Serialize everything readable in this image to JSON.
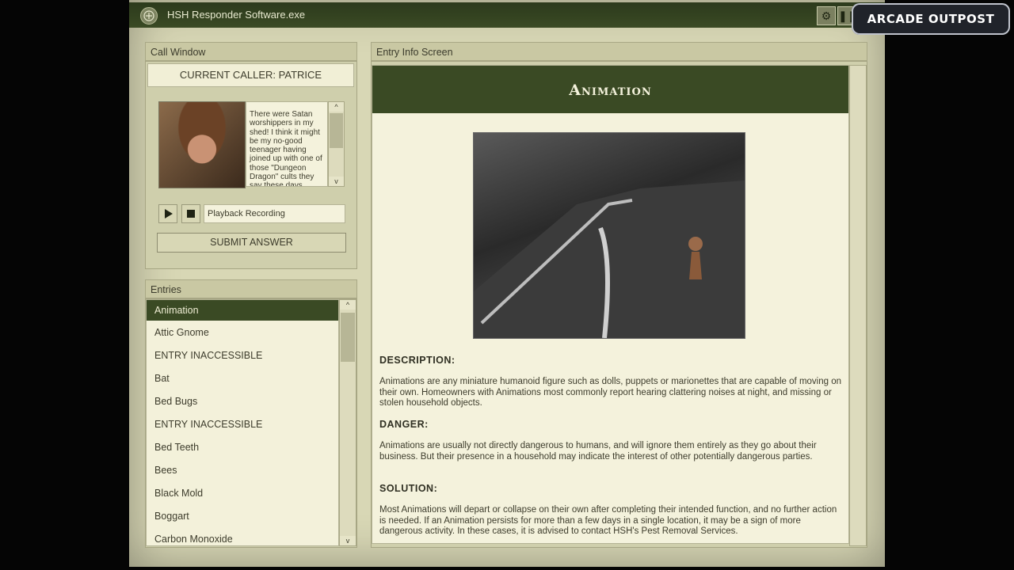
{
  "window": {
    "title": "HSH Responder Software.exe"
  },
  "watermark": {
    "text": "ARCADE OUTPOST"
  },
  "call_window": {
    "header": "Call Window",
    "current_caller": "CURRENT CALLER: PATRICE",
    "transcript": "There were Satan worshippers in my shed! I think it might be my no-good teenager having joined up with one of those \"Dungeon Dragon\" cults they say these days...",
    "playback_label": "Playback Recording",
    "submit_label": "SUBMIT ANSWER"
  },
  "entries": {
    "header": "Entries",
    "items": [
      "Animation",
      "Attic Gnome",
      "ENTRY INACCESSIBLE",
      "Bat",
      "Bed Bugs",
      "ENTRY INACCESSIBLE",
      "Bed Teeth",
      "Bees",
      "Black Mold",
      "Boggart",
      "Carbon Monoxide"
    ],
    "selected": "Animation"
  },
  "entry_info": {
    "header": "Entry Info Screen",
    "title": "Animation",
    "description_head": "DESCRIPTION:",
    "description": "Animations are any miniature humanoid figure such as dolls, puppets or marionettes that are capable of moving on their own. Homeowners with Animations most commonly report hearing clattering noises at night, and missing or stolen household objects.",
    "danger_head": "DANGER:",
    "danger": "Animations are usually not directly dangerous to humans, and will ignore them entirely as they go about their business. But their presence in a household may indicate the interest of other potentially dangerous parties.",
    "solution_head": "SOLUTION:",
    "solution": "Most Animations will depart or collapse on their own after completing their intended function, and no further action is needed. If an Animation persists for more than a few days in a single location, it may be a sign of more dangerous activity. In these cases, it is advised to contact HSH's Pest Removal Services."
  },
  "colors": {
    "accent": "#3a4a24",
    "panel": "#cfcfac",
    "paper": "#f4f2dc"
  },
  "icons": {
    "settings": "gear-icon",
    "pause": "pause-icon",
    "play": "play-icon",
    "stop": "stop-icon"
  }
}
